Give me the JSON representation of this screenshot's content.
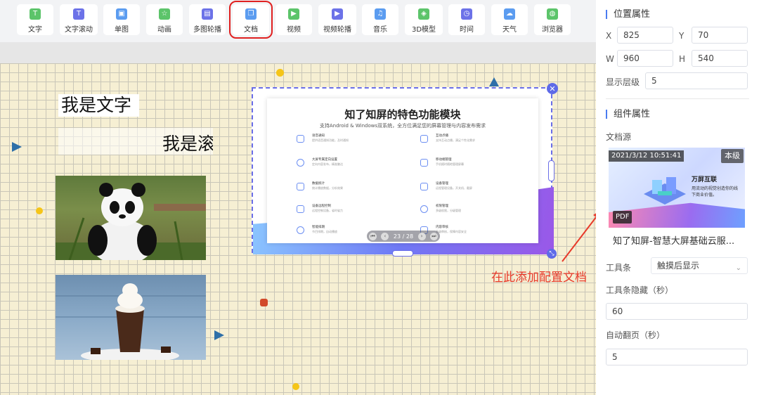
{
  "toolbar": {
    "items": [
      {
        "label": "文字",
        "icon": "text-icon",
        "color": "#5cc46a"
      },
      {
        "label": "文字滚动",
        "icon": "scroll-text-icon",
        "color": "#6c72e8"
      },
      {
        "label": "单图",
        "icon": "image-icon",
        "color": "#5b9cf0"
      },
      {
        "label": "动画",
        "icon": "animation-icon",
        "color": "#5cc46a"
      },
      {
        "label": "多图轮播",
        "icon": "carousel-icon",
        "color": "#6c72e8"
      },
      {
        "label": "文档",
        "icon": "document-icon",
        "color": "#5b9cf0"
      },
      {
        "label": "视频",
        "icon": "video-icon",
        "color": "#5cc46a"
      },
      {
        "label": "视频轮播",
        "icon": "video-carousel-icon",
        "color": "#6c72e8"
      },
      {
        "label": "音乐",
        "icon": "music-icon",
        "color": "#5b9cf0"
      },
      {
        "label": "3D模型",
        "icon": "cube-icon",
        "color": "#5cc46a"
      },
      {
        "label": "时间",
        "icon": "clock-icon",
        "color": "#6c72e8"
      },
      {
        "label": "天气",
        "icon": "cloud-icon",
        "color": "#5b9cf0"
      },
      {
        "label": "浏览器",
        "icon": "globe-icon",
        "color": "#5cc46a"
      }
    ],
    "active_index": 5,
    "highlight_color": "#e02020"
  },
  "canvas": {
    "text_widget": "我是文字",
    "scroll_text_widget": "我是滚动文字",
    "document": {
      "title": "知了知屏的特色功能模块",
      "subtitle": "支持Android & Windows双系统，全方位满足您的屏幕管理与内容发布需求",
      "features": [
        {
          "title": "语音通知",
          "desc": "提供语音通知功能，及时通知"
        },
        {
          "title": "互动点播",
          "desc": "支持互动点播，满足个性化需求"
        },
        {
          "title": "大屏专属定向设置",
          "desc": "定向内容发布，精准触达"
        },
        {
          "title": "移动端管理",
          "desc": "手机随时随地管理屏幕"
        },
        {
          "title": "数据统计",
          "desc": "统计播放数据，分析效果"
        },
        {
          "title": "设备管理",
          "desc": "远程管理设备，开关机、截屏"
        },
        {
          "title": "设备远程控制",
          "desc": "远程控制设备，省时省力"
        },
        {
          "title": "权限管理",
          "desc": "多级权限，分级管理"
        },
        {
          "title": "智能排期",
          "desc": "节目排期，自动播放"
        },
        {
          "title": "内容审核",
          "desc": "多级审核，保障内容安全"
        }
      ],
      "pager": {
        "current": 23,
        "total": 28,
        "text": "23 / 28"
      }
    },
    "annotation": "在此添加配置文档"
  },
  "panel": {
    "position_title": "位置属性",
    "x_label": "X",
    "x_value": "825",
    "y_label": "Y",
    "y_value": "70",
    "w_label": "W",
    "w_value": "960",
    "h_label": "H",
    "h_value": "540",
    "layer_label": "显示层级",
    "layer_value": "5",
    "component_title": "组件属性",
    "doc_source_label": "文档源",
    "thumb_time": "2021/3/12 10:51:41",
    "thumb_local": "本级",
    "thumb_pdf": "PDF",
    "thumb_brand": "万屏互联",
    "thumb_tagline": "用流动的视觉创造你的线下商业价值。",
    "doc_name": "知了知屏-智慧大屏基础云服...",
    "toolbar_label": "工具条",
    "toolbar_value": "触摸后显示",
    "toolbar_hide_label": "工具条隐藏（秒）",
    "toolbar_hide_value": "60",
    "auto_flip_label": "自动翻页（秒）",
    "auto_flip_value": "5"
  }
}
